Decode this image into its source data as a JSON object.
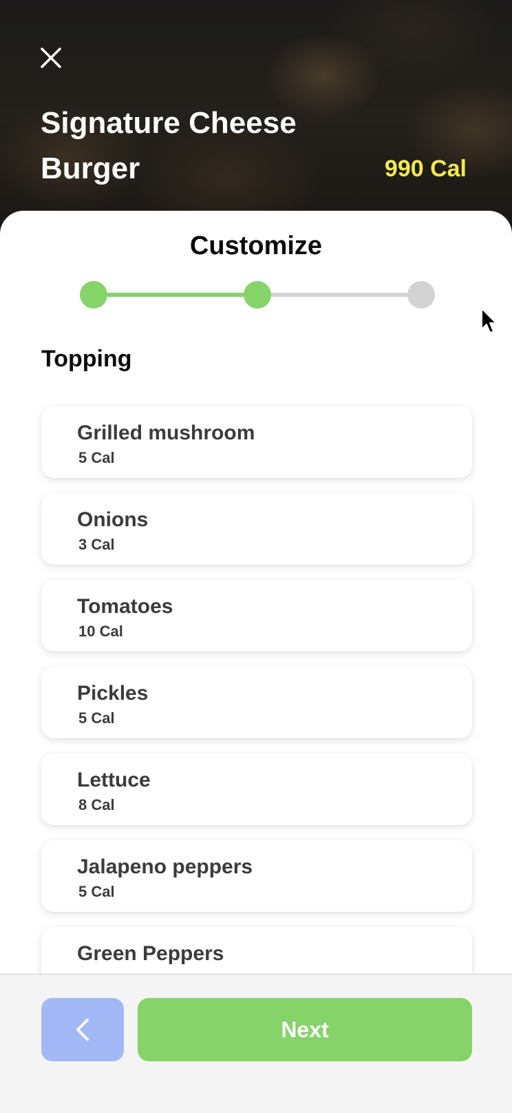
{
  "header": {
    "title": "Signature Cheese Burger",
    "calories": "990 Cal",
    "close_icon": "close-icon"
  },
  "customize": {
    "title": "Customize",
    "steps_total": 3,
    "steps_completed": 2,
    "colors": {
      "active": "#86d36a",
      "inactive": "#d3d3d3"
    }
  },
  "section": {
    "label": "Topping"
  },
  "toppings": [
    {
      "name": "Grilled mushroom",
      "cal": "5 Cal"
    },
    {
      "name": "Onions",
      "cal": "3 Cal"
    },
    {
      "name": "Tomatoes",
      "cal": "10 Cal"
    },
    {
      "name": "Pickles",
      "cal": "5 Cal"
    },
    {
      "name": "Lettuce",
      "cal": "8 Cal"
    },
    {
      "name": "Jalapeno peppers",
      "cal": "5 Cal"
    },
    {
      "name": "Green Peppers",
      "cal": ""
    }
  ],
  "footer": {
    "back_icon": "chevron-left-icon",
    "next_label": "Next",
    "colors": {
      "back": "#a3b8f6",
      "next": "#86d36a"
    }
  }
}
